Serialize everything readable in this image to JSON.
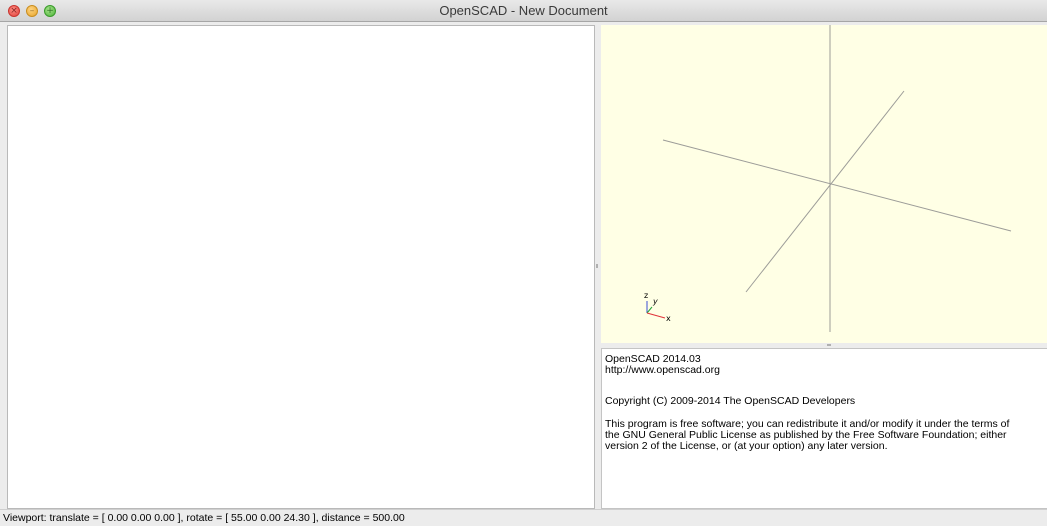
{
  "window": {
    "title": "OpenSCAD - New Document",
    "close_glyph": "×",
    "minimize_glyph": "–",
    "zoom_glyph": "+"
  },
  "editor": {
    "content": ""
  },
  "viewport": {
    "background_color": "#ffffe5",
    "axis_color": "#9c9c98",
    "axes_widget": {
      "z_label": "z",
      "y_label": "y",
      "x_label": "x",
      "z_color": "#3b4fd4",
      "y_color": "#23a23a",
      "x_color": "#e0323a"
    }
  },
  "console": {
    "lines": [
      "OpenSCAD 2014.03",
      "http://www.openscad.org",
      "Copyright (C) 2009-2014 The OpenSCAD Developers",
      "This program is free software; you can redistribute it and/or modify it under the terms of",
      "the GNU General Public License as published by the Free Software Foundation; either",
      "version 2 of the License, or (at your option) any later version."
    ]
  },
  "statusbar": {
    "text": "Viewport: translate = [ 0.00 0.00 0.00 ], rotate = [ 55.00 0.00 24.30 ], distance = 500.00"
  }
}
